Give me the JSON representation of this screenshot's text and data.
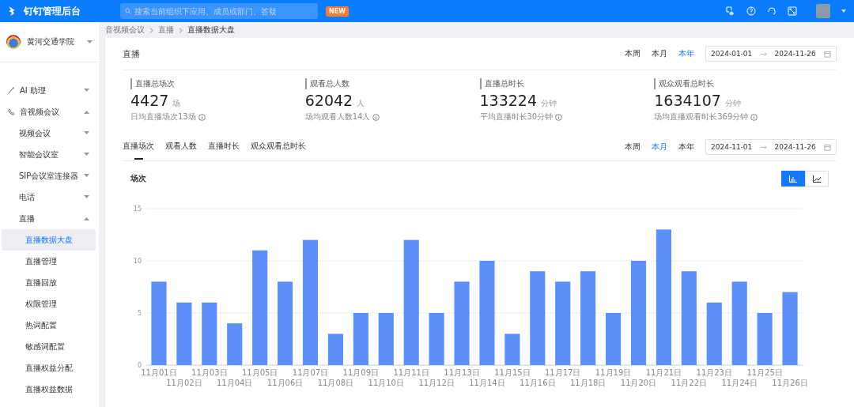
{
  "header": {
    "title": "钉钉管理后台",
    "search_placeholder": "搜索当前组织下应用、成员或部门、答疑",
    "badge": "NEW"
  },
  "org": {
    "name": "黄河交通学院"
  },
  "sidebar": [
    {
      "label": "AI 助理",
      "kind": "ai",
      "expanded": false,
      "selected": false
    },
    {
      "label": "音视频会议",
      "kind": "meeting",
      "expanded": true,
      "selected": false,
      "children": [
        {
          "label": "视频会议",
          "expanded": false,
          "selected": false
        },
        {
          "label": "智能会议室",
          "expanded": false,
          "selected": false
        },
        {
          "label": "SIP会议室连接器",
          "expanded": false,
          "selected": false
        },
        {
          "label": "电话",
          "expanded": false,
          "selected": false
        },
        {
          "label": "直播",
          "expanded": true,
          "selected": false,
          "children": [
            {
              "label": "直播数据大盘",
              "selected": true
            },
            {
              "label": "直播管理",
              "selected": false
            },
            {
              "label": "直播回放",
              "selected": false
            },
            {
              "label": "权限管理",
              "selected": false
            },
            {
              "label": "热词配置",
              "selected": false
            },
            {
              "label": "敏感词配置",
              "selected": false
            },
            {
              "label": "直播权益分配",
              "selected": false
            },
            {
              "label": "直播权益数据",
              "selected": false
            }
          ]
        }
      ]
    }
  ],
  "breadcrumb": [
    "音视频会议",
    "直播",
    "直播数据大盘"
  ],
  "overview": {
    "title": "直播",
    "periods": [
      {
        "label": "本周",
        "selected": false
      },
      {
        "label": "本月",
        "selected": false
      },
      {
        "label": "本年",
        "selected": true
      }
    ],
    "date_start": "2024-01-01",
    "date_end": "2024-11-26"
  },
  "stats": [
    {
      "label": "直播总场次",
      "value": "4427",
      "unit": "场",
      "note": "日均直播场次13场"
    },
    {
      "label": "观看总人数",
      "value": "62042",
      "unit": "人",
      "note": "场均观看人数14人"
    },
    {
      "label": "直播总时长",
      "value": "133224",
      "unit": "分钟",
      "note": "平均直播时长30分钟"
    },
    {
      "label": "观众观看总时长",
      "value": "1634107",
      "unit": "分钟",
      "note": "场均直播观看时长369分钟"
    }
  ],
  "metric_tabs": [
    {
      "label": "直播场次",
      "selected": true
    },
    {
      "label": "观看人数",
      "selected": false
    },
    {
      "label": "直播时长",
      "selected": false
    },
    {
      "label": "观众观看总时长",
      "selected": false
    }
  ],
  "trend": {
    "periods": [
      {
        "label": "本周",
        "selected": false
      },
      {
        "label": "本月",
        "selected": true
      },
      {
        "label": "本年",
        "selected": false
      }
    ],
    "date_start": "2024-11-01",
    "date_end": "2024-11-26",
    "chart_toggle": [
      {
        "kind": "bar",
        "selected": true
      },
      {
        "kind": "line",
        "selected": false
      }
    ],
    "chart_data": {
      "type": "bar",
      "title": "场次",
      "categories": [
        "11月01日",
        "11月02日",
        "11月03日",
        "11月04日",
        "11月05日",
        "11月06日",
        "11月07日",
        "11月08日",
        "11月09日",
        "11月10日",
        "11月11日",
        "11月12日",
        "11月13日",
        "11月14日",
        "11月15日",
        "11月16日",
        "11月17日",
        "11月18日",
        "11月19日",
        "11月20日",
        "11月21日",
        "11月22日",
        "11月23日",
        "11月24日",
        "11月25日",
        "11月26日"
      ],
      "series": [
        {
          "color": "#5b8ff9",
          "values": [
            8,
            6,
            6,
            4,
            11,
            8,
            12,
            3,
            5,
            5,
            12,
            5,
            8,
            10,
            3,
            9,
            8,
            9,
            5,
            10,
            13,
            9,
            6,
            8,
            5,
            7
          ]
        }
      ],
      "ylim": [
        0,
        15
      ],
      "yticks": [
        0,
        5,
        10,
        15
      ]
    }
  }
}
